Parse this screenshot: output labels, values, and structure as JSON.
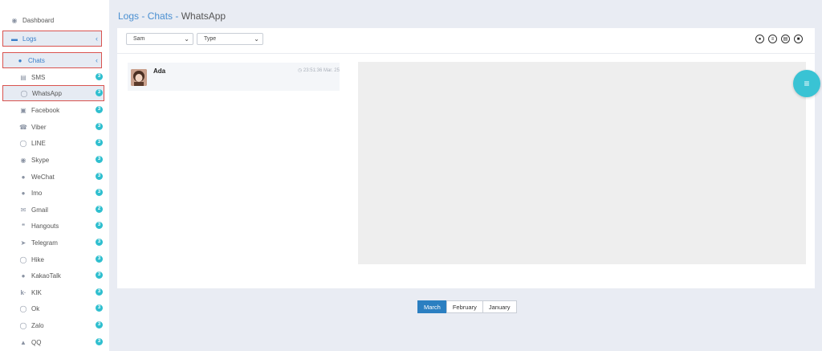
{
  "sidebar": {
    "dashboard": "Dashboard",
    "logs": "Logs",
    "chats": "Chats",
    "items": [
      {
        "label": "SMS",
        "count": "3"
      },
      {
        "label": "WhatsApp",
        "count": "3"
      },
      {
        "label": "Facebook",
        "count": "3"
      },
      {
        "label": "Viber",
        "count": "3"
      },
      {
        "label": "LINE",
        "count": "3"
      },
      {
        "label": "Skype",
        "count": "3"
      },
      {
        "label": "WeChat",
        "count": "3"
      },
      {
        "label": "Imo",
        "count": "3"
      },
      {
        "label": "Gmail",
        "count": "2"
      },
      {
        "label": "Hangouts",
        "count": "3"
      },
      {
        "label": "Telegram",
        "count": "3"
      },
      {
        "label": "Hike",
        "count": "3"
      },
      {
        "label": "KakaoTalk",
        "count": "3"
      },
      {
        "label": "KIK",
        "count": "3"
      },
      {
        "label": "Ok",
        "count": "3"
      },
      {
        "label": "Zalo",
        "count": "3"
      },
      {
        "label": "QQ",
        "count": "3"
      }
    ]
  },
  "breadcrumb": {
    "logs": "Logs",
    "sep1": " - ",
    "chats": "Chats",
    "sep2": " - ",
    "current": "WhatsApp"
  },
  "filters": {
    "device": "Sam",
    "type": "Type"
  },
  "chat": {
    "name": "Ada",
    "time": "23:51:36 Mar. 25"
  },
  "months": [
    "March",
    "February",
    "January"
  ],
  "colors": {
    "accent": "#2b7fc1",
    "badge": "#2fbfcf",
    "highlight": "#d9534f",
    "fab": "#39c3d4"
  }
}
